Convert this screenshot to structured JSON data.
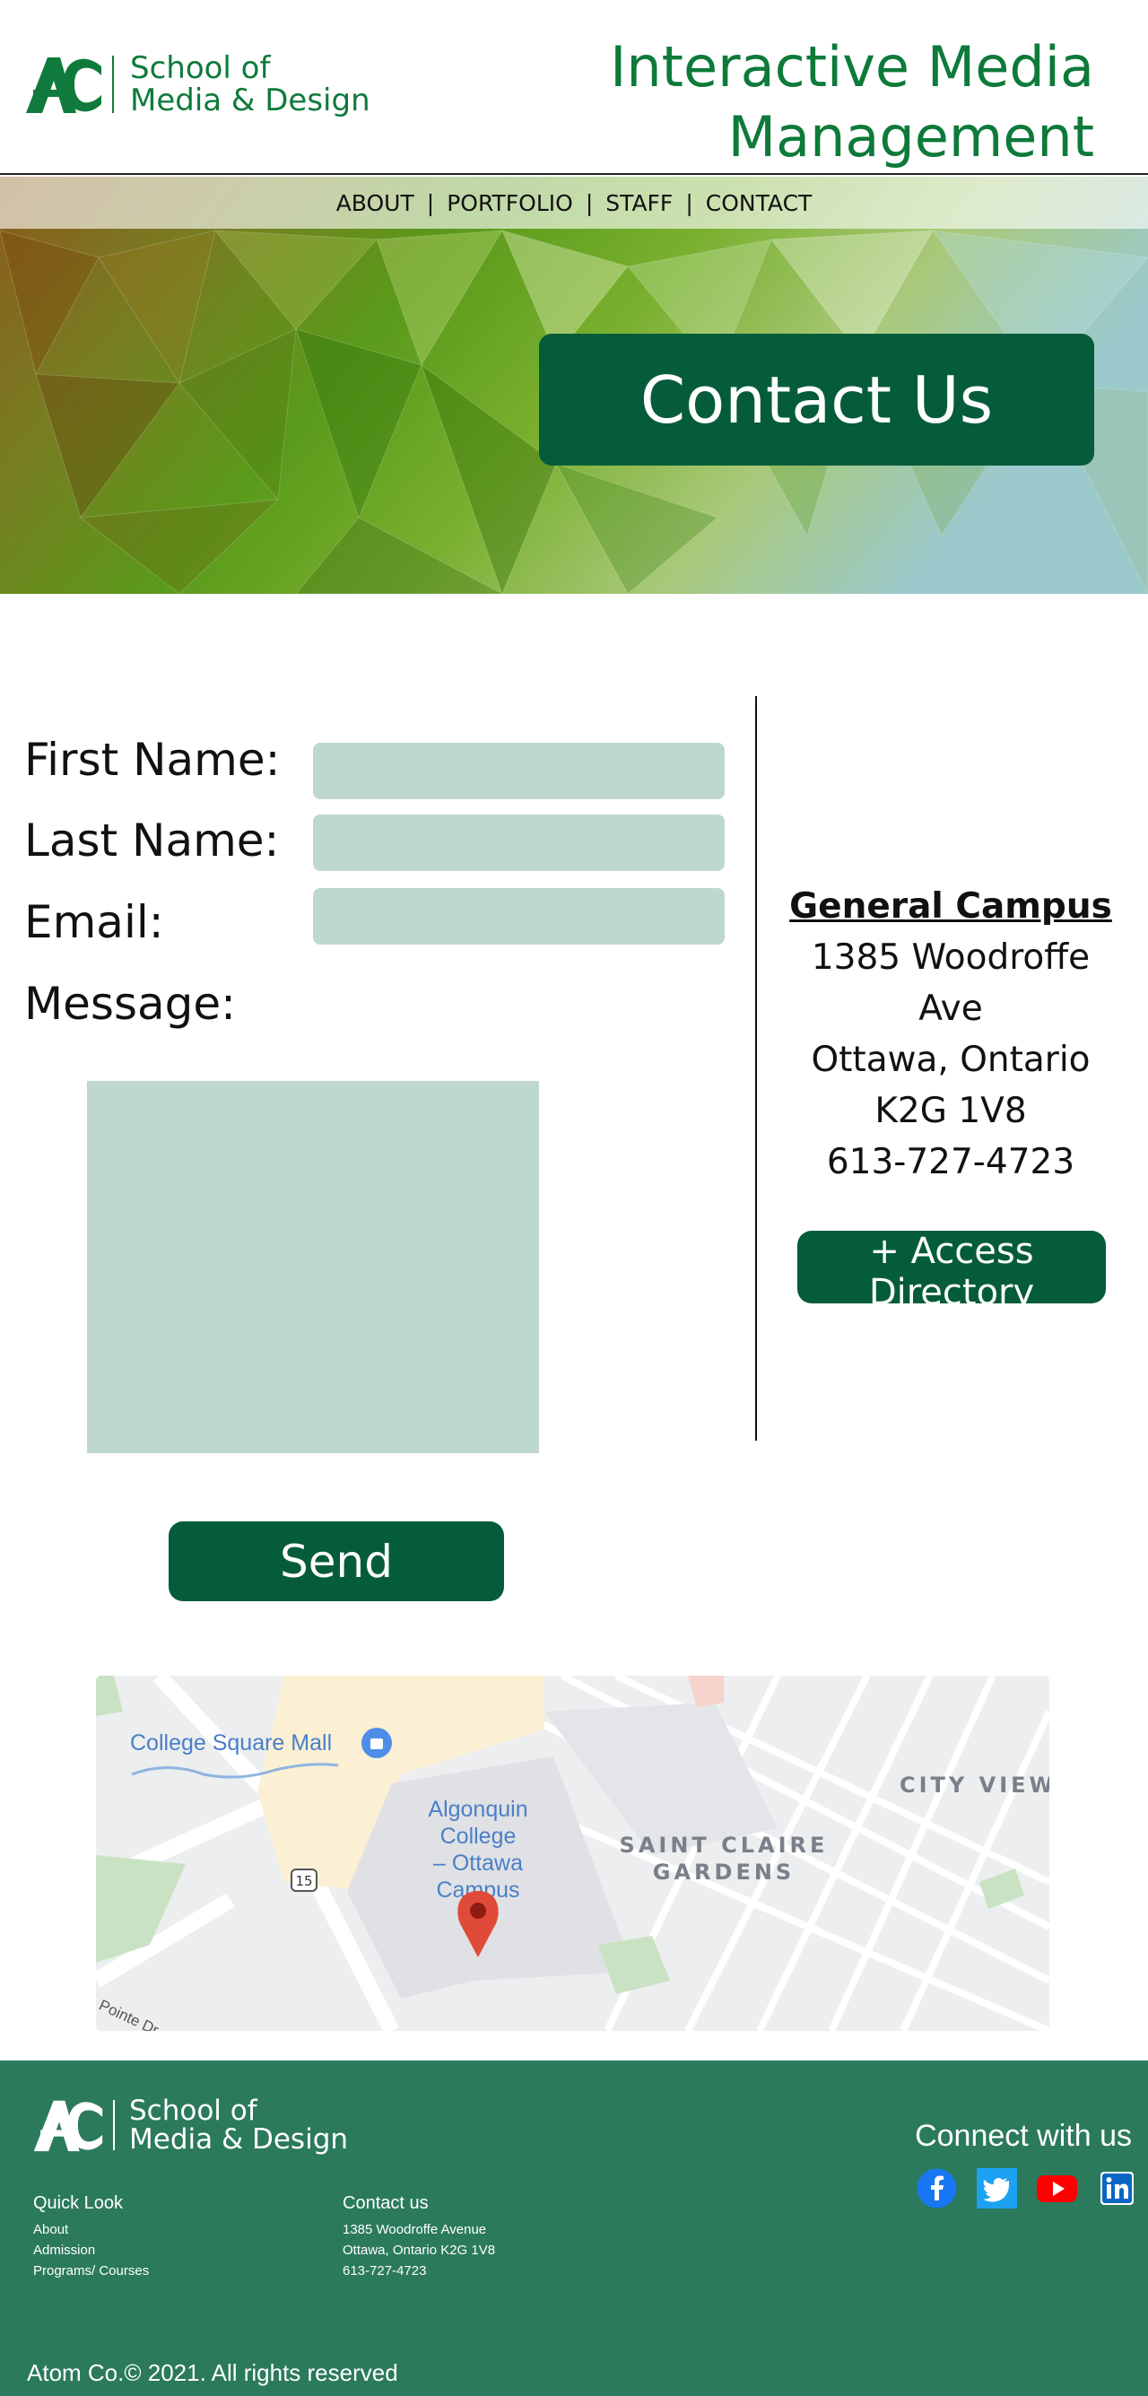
{
  "header": {
    "logo_mark": "AC",
    "logo_line1": "School of",
    "logo_line2": "Media & Design",
    "title_line1": "Interactive Media",
    "title_line2": "Management"
  },
  "nav": {
    "items": [
      "ABOUT",
      "PORTFOLIO",
      "STAFF",
      "CONTACT"
    ],
    "separator": "|"
  },
  "hero": {
    "title": "Contact Us"
  },
  "form": {
    "first_name_label": "First Name:",
    "last_name_label": "Last Name:",
    "email_label": "Email:",
    "message_label": "Message:",
    "send_label": "Send"
  },
  "campus": {
    "title": "General Campus",
    "line1": "1385 Woodroffe",
    "line2": "Ave",
    "line3": "Ottawa, Ontario",
    "line4": "K2G 1V8",
    "phone": "613-727-4723",
    "directory_label": "+ Access Directory"
  },
  "map": {
    "label_mall": "College Square Mall",
    "label_college_1": "Algonquin",
    "label_college_2": "College",
    "label_college_3": "– Ottawa",
    "label_college_4": "Campus",
    "label_city_view": "CITY VIEW",
    "label_saint_claire_1": "SAINT CLAIRE",
    "label_saint_claire_2": "GARDENS",
    "route_shield": "15",
    "label_street": "Pointe Dr"
  },
  "footer": {
    "logo_mark": "AC",
    "logo_line1": "School of",
    "logo_line2": "Media & Design",
    "connect": "Connect with us",
    "social": [
      "facebook-icon",
      "twitter-icon",
      "youtube-icon",
      "linkedin-icon"
    ],
    "quick_look": {
      "heading": "Quick Look",
      "links": [
        "About",
        "Admission",
        "Programs/ Courses"
      ]
    },
    "contact": {
      "heading": "Contact us",
      "lines": [
        "1385 Woodroffe Avenue",
        "Ottawa, Ontario K2G 1V8",
        "613-727-4723"
      ]
    },
    "copyright": "Atom Co.© 2021. All rights reserved"
  },
  "colors": {
    "brand_green": "#0d7a3a",
    "dark_green": "#055c3a",
    "field_fill": "#bfd8cf",
    "footer_bg": "#2b7a5c"
  }
}
